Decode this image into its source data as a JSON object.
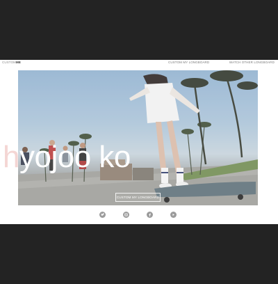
{
  "header": {
    "brand_prefix": "CUSTOM",
    "brand_suffix": "ME",
    "nav_custom": "CUSTOM MY LONGBOARD",
    "nav_watch": "WATCH OTHER LONGBOARD"
  },
  "hero": {
    "title_first": "h",
    "title_rest": "yojoo ko",
    "cta_label": "CUSTOM MY LONGBOARD"
  },
  "social": {
    "icons": [
      "twitter-icon",
      "instagram-icon",
      "facebook-icon",
      "play-icon"
    ],
    "icon_color": "#9b9b9b"
  },
  "colors": {
    "background": "#232323",
    "page": "#ffffff",
    "title_accent": "#f4d6d4"
  }
}
